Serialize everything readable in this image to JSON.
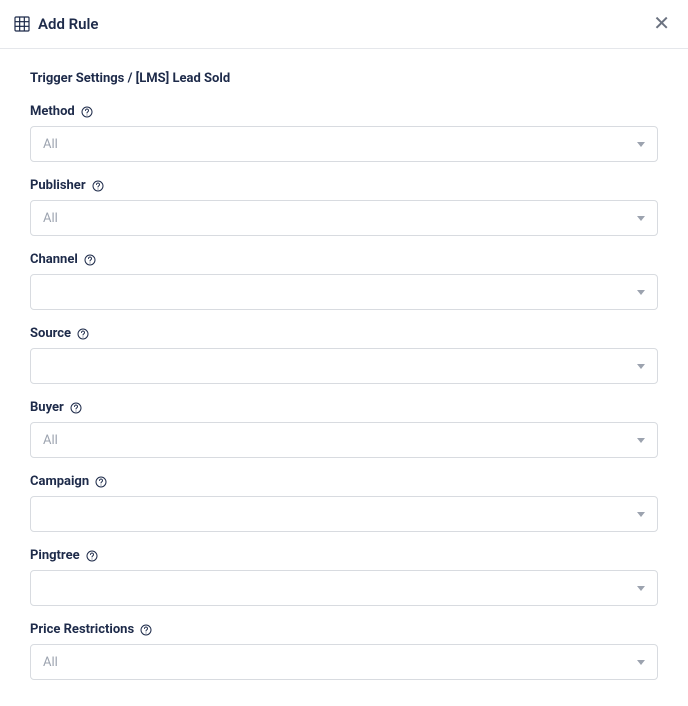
{
  "header": {
    "title": "Add Rule"
  },
  "breadcrumb": "Trigger Settings / [LMS] Lead Sold",
  "fields": {
    "method": {
      "label": "Method",
      "value": "All"
    },
    "publisher": {
      "label": "Publisher",
      "value": "All"
    },
    "channel": {
      "label": "Channel",
      "value": ""
    },
    "source": {
      "label": "Source",
      "value": ""
    },
    "buyer": {
      "label": "Buyer",
      "value": "All"
    },
    "campaign": {
      "label": "Campaign",
      "value": ""
    },
    "pingtree": {
      "label": "Pingtree",
      "value": ""
    },
    "price_restrictions": {
      "label": "Price Restrictions",
      "value": "All"
    }
  }
}
